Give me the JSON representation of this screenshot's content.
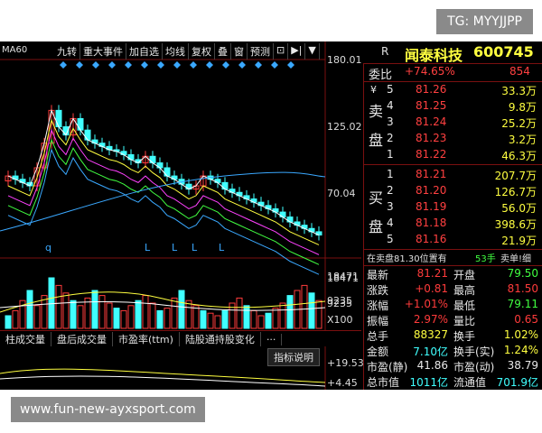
{
  "watermarks": {
    "top": "TG: MYYJJPP",
    "bottom": "www.fun-new-ayxsport.com"
  },
  "chart": {
    "indicator_label": "MA60",
    "toolbar": [
      "九转",
      "重大事件",
      "加自选",
      "均线",
      "复权",
      "叠",
      "窗",
      "预测",
      "⊡",
      "▶|",
      "▼"
    ],
    "price_axis": [
      "180.01",
      "125.02",
      "70.04"
    ],
    "volume_axis": [
      "18471",
      "9235",
      "X100"
    ],
    "volume_tabs": [
      "柱成交量",
      "盘后成交量",
      "市盈率(ttm)",
      "陆股通持股变化",
      "···"
    ],
    "sub_tab": "指标说明",
    "sub_axis": [
      "+19.53",
      "+4.45"
    ],
    "markers": [
      "q",
      "L",
      "L",
      "L",
      "L"
    ]
  },
  "quote": {
    "code_prefix": "R",
    "name": "闻泰科技",
    "code": "600745",
    "weibi": {
      "label": "委比",
      "pct": "+74.65%",
      "val": "854"
    },
    "sell_label": [
      "卖",
      "盘"
    ],
    "sell_prefix": "¥",
    "sell": [
      {
        "n": "5",
        "price": "81.26",
        "vol": "33.3万"
      },
      {
        "n": "4",
        "price": "81.25",
        "vol": "9.8万"
      },
      {
        "n": "3",
        "price": "81.24",
        "vol": "25.2万"
      },
      {
        "n": "2",
        "price": "81.23",
        "vol": "3.2万"
      },
      {
        "n": "1",
        "price": "81.22",
        "vol": "46.3万"
      }
    ],
    "buy_label": [
      "买",
      "盘"
    ],
    "buy": [
      {
        "n": "1",
        "price": "81.21",
        "vol": "207.7万"
      },
      {
        "n": "2",
        "price": "81.20",
        "vol": "126.7万"
      },
      {
        "n": "3",
        "price": "81.19",
        "vol": "56.0万"
      },
      {
        "n": "4",
        "price": "81.18",
        "vol": "398.6万"
      },
      {
        "n": "5",
        "price": "81.16",
        "vol": "21.9万"
      }
    ],
    "notice": {
      "text": "在卖盘81.30位置有",
      "hands": "53手",
      "tail": "卖单!细"
    },
    "stats": [
      {
        "l1": "最新",
        "v1": "81.21",
        "l2": "开盘",
        "v2": "79.50",
        "c1": "red",
        "c2": "green"
      },
      {
        "l1": "涨跌",
        "v1": "+0.81",
        "l2": "最高",
        "v2": "81.50",
        "c1": "red",
        "c2": "red"
      },
      {
        "l1": "涨幅",
        "v1": "+1.01%",
        "l2": "最低",
        "v2": "79.11",
        "c1": "red",
        "c2": "green"
      },
      {
        "l1": "振幅",
        "v1": "2.97%",
        "l2": "量比",
        "v2": "0.65",
        "c1": "red",
        "c2": "red"
      },
      {
        "l1": "总手",
        "v1": "88327",
        "l2": "换手",
        "v2": "1.02%",
        "c1": "yellow",
        "c2": "yellow"
      },
      {
        "l1": "金额",
        "v1": "7.10亿",
        "l2": "换手(实)",
        "v2": "1.24%",
        "c1": "cyan",
        "c2": "yellow"
      },
      {
        "l1": "市盈(静)",
        "v1": "41.86",
        "l2": "市盈(动)",
        "v2": "38.79",
        "c1": "white",
        "c2": "white"
      },
      {
        "l1": "总市值",
        "v1": "1011亿",
        "l2": "流通值",
        "v2": "701.9亿",
        "c1": "cyan",
        "c2": "cyan"
      }
    ]
  }
}
